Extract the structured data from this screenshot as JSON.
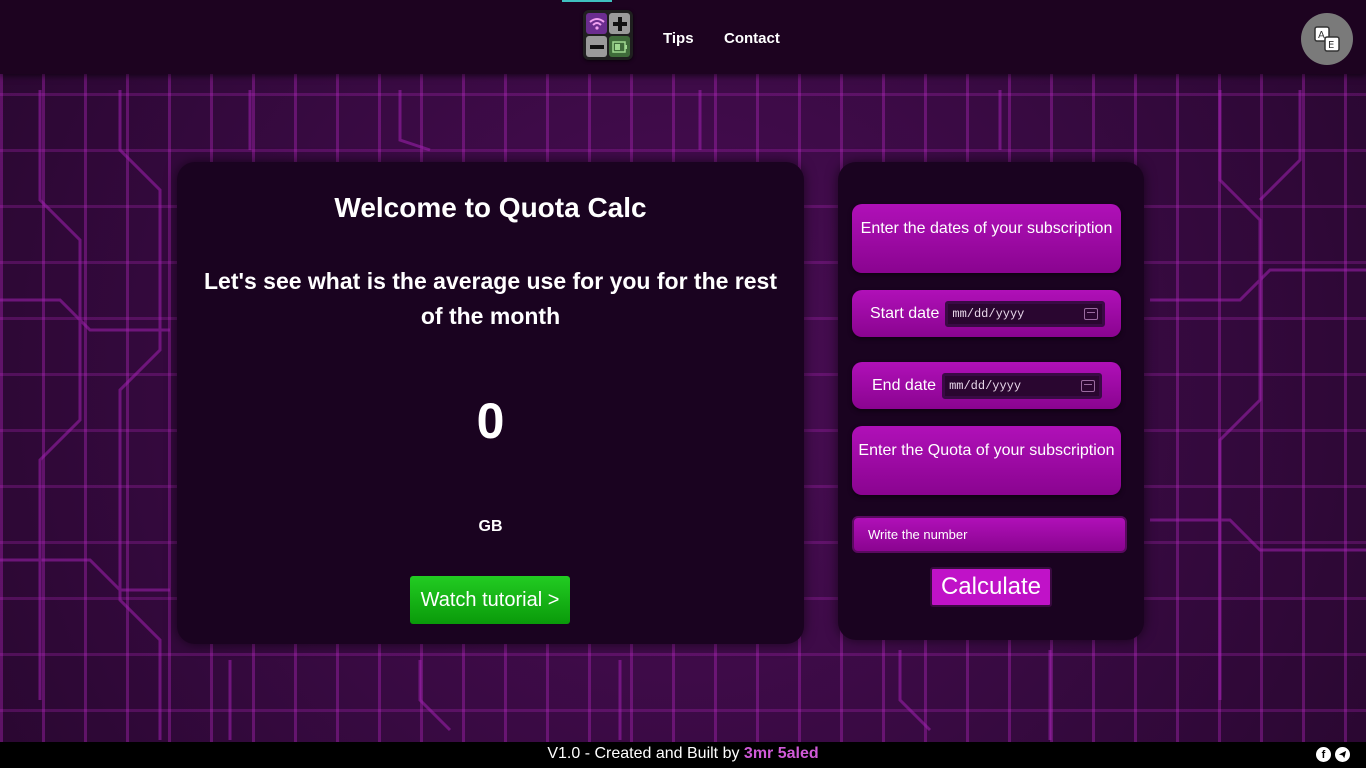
{
  "nav": {
    "tips_label": "Tips",
    "contact_label": "Contact"
  },
  "main": {
    "title": "Welcome to Quota Calc",
    "subtitle": "Let's see what is the average use for you for the rest of the month",
    "result_value": "0",
    "result_unit": "GB",
    "tutorial_label": "Watch tutorial >"
  },
  "form": {
    "dates_info": "Enter the dates of your subscription",
    "start_label": "Start date",
    "start_value": "mm/dd/yyyy",
    "end_label": "End date",
    "end_value": "mm/dd/yyyy",
    "quota_info": "Enter the Quota of your subscription",
    "quota_placeholder": "Write the number",
    "calculate_label": "Calculate"
  },
  "footer": {
    "text": "V1.0 - Created and Built by ",
    "author": "3mr 5aled"
  },
  "colors": {
    "accent": "#b010b8",
    "tutorial_button": "#11b511",
    "author": "#d05ad8"
  },
  "icons": {
    "language": "translate-icon",
    "social": [
      "facebook-icon",
      "telegram-icon"
    ]
  }
}
